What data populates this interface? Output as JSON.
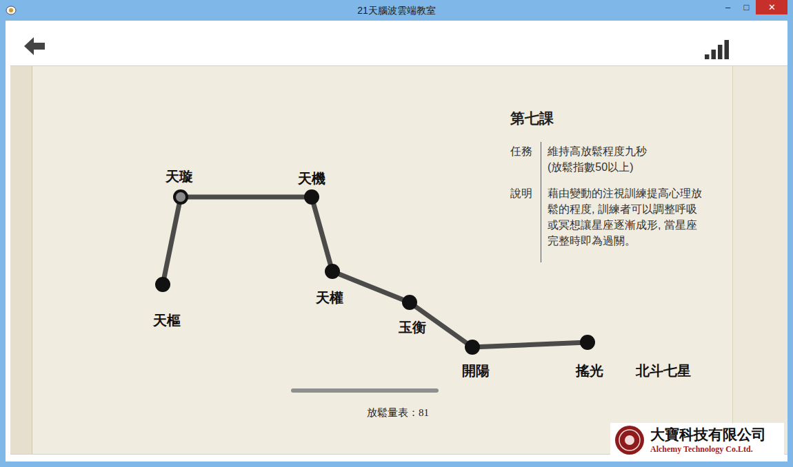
{
  "window": {
    "title": "21天腦波雲端教室",
    "controls": [
      "‒",
      "□",
      "✕"
    ]
  },
  "toolbar": {
    "signal": {
      "level": 1
    }
  },
  "constellation": {
    "title": "北斗七星",
    "stars": [
      {
        "name": "天樞",
        "active": false
      },
      {
        "name": "天璇",
        "active": true
      },
      {
        "name": "天機",
        "active": false
      },
      {
        "name": "天權",
        "active": false
      },
      {
        "name": "玉衡",
        "active": false
      },
      {
        "name": "開陽",
        "active": false
      },
      {
        "name": "搖光",
        "active": false
      }
    ],
    "lines": [
      {
        "from": "天樞",
        "to": "天璇",
        "drawn": true
      },
      {
        "from": "天璇",
        "to": "天機",
        "drawn": true
      },
      {
        "from": "天機",
        "to": "天權",
        "drawn": true
      },
      {
        "from": "天權",
        "to": "玉衡",
        "drawn": true
      },
      {
        "from": "玉衡",
        "to": "開陽",
        "drawn": true
      },
      {
        "from": "開陽",
        "to": "搖光",
        "drawn": true
      }
    ]
  },
  "lesson": {
    "title": "第七課",
    "task_label": "任務",
    "task_lines": [
      "維持高放鬆程度九秒",
      "(放鬆指數50以上)"
    ],
    "desc_label": "說明",
    "desc_lines": [
      "藉由變動的注視訓練提高心理放",
      "鬆的程度, 訓練者可以調整呼吸",
      "或冥想讓星座逐漸成形, 當星座",
      "完整時即為過關。"
    ]
  },
  "meter": {
    "label": "放鬆量表：81",
    "level": 0.81
  },
  "logo": {
    "name": "大寶科技有限公司",
    "english": "Alchemy Technology Co.Ltd."
  }
}
